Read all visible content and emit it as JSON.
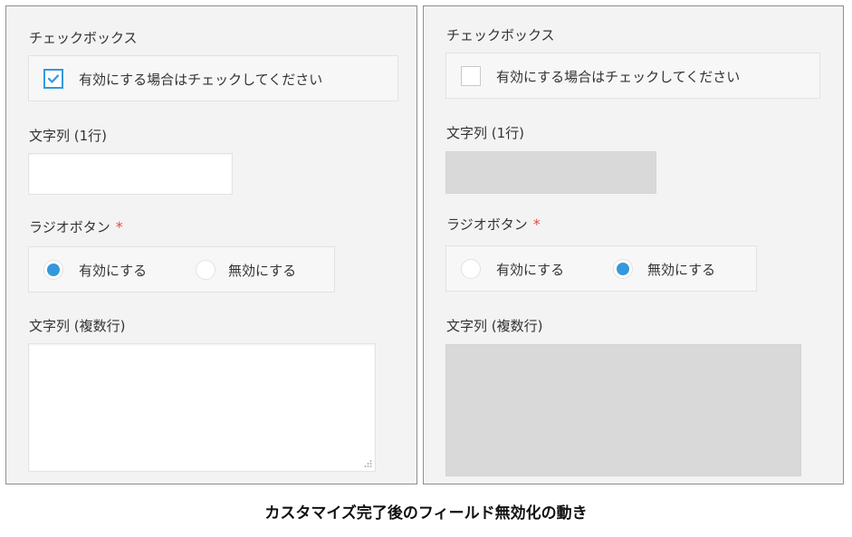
{
  "left": {
    "checkbox_field_label": "チェックボックス",
    "checkbox_option_label": "有効にする場合はチェックしてください",
    "checkbox_checked": true,
    "text_single_label": "文字列 (1行)",
    "text_single_value": "",
    "radio_label": "ラジオボタン",
    "required_mark": "*",
    "radio_options": [
      "有効にする",
      "無効にする"
    ],
    "radio_selected": "有効にする",
    "text_multi_label": "文字列 (複数行)",
    "text_multi_value": ""
  },
  "right": {
    "checkbox_field_label": "チェックボックス",
    "checkbox_option_label": "有効にする場合はチェックしてください",
    "checkbox_checked": false,
    "text_single_label": "文字列 (1行)",
    "text_single_value": "",
    "text_single_disabled": true,
    "radio_label": "ラジオボタン",
    "required_mark": "*",
    "radio_options": [
      "有効にする",
      "無効にする"
    ],
    "radio_selected": "無効にする",
    "text_multi_label": "文字列 (複数行)",
    "text_multi_value": "",
    "text_multi_disabled": true
  },
  "caption": "カスタマイズ完了後のフィールド無効化の動き",
  "colors": {
    "accent": "#3498db",
    "required": "#e74c3c",
    "panel_bg": "#f3f3f3",
    "disabled_bg": "#d9d9d9"
  }
}
